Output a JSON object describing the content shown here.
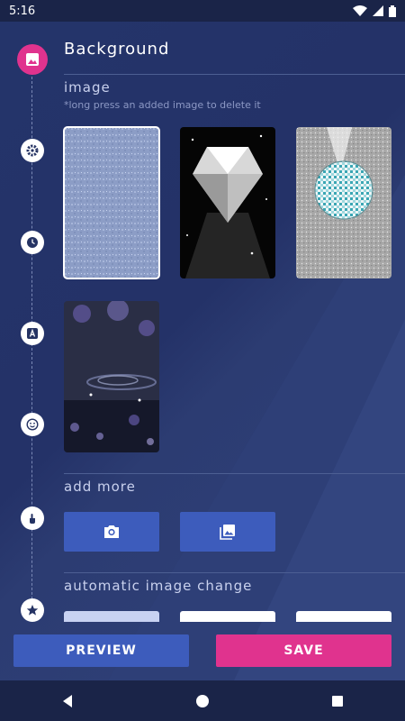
{
  "status": {
    "time": "5:16"
  },
  "header": {
    "title": "Background"
  },
  "image_section": {
    "label": "image",
    "hint": "*long press an added image to delete it",
    "thumbnails": [
      {
        "name": "glitter-blue",
        "selected": true
      },
      {
        "name": "diamond",
        "selected": false
      },
      {
        "name": "disco-ball",
        "selected": false
      },
      {
        "name": "purple-bokeh",
        "selected": false
      }
    ]
  },
  "add_more": {
    "label": "add more"
  },
  "auto_change": {
    "label": "automatic image change"
  },
  "actions": {
    "preview": "PREVIEW",
    "save": "SAVE"
  },
  "colors": {
    "accent_pink": "#e0338e",
    "accent_blue": "#3d5cbc",
    "background": "#253363"
  },
  "rail": [
    "image-icon",
    "gear-icon",
    "clock-icon",
    "text-icon",
    "smiley-icon",
    "touch-icon",
    "star-icon"
  ]
}
